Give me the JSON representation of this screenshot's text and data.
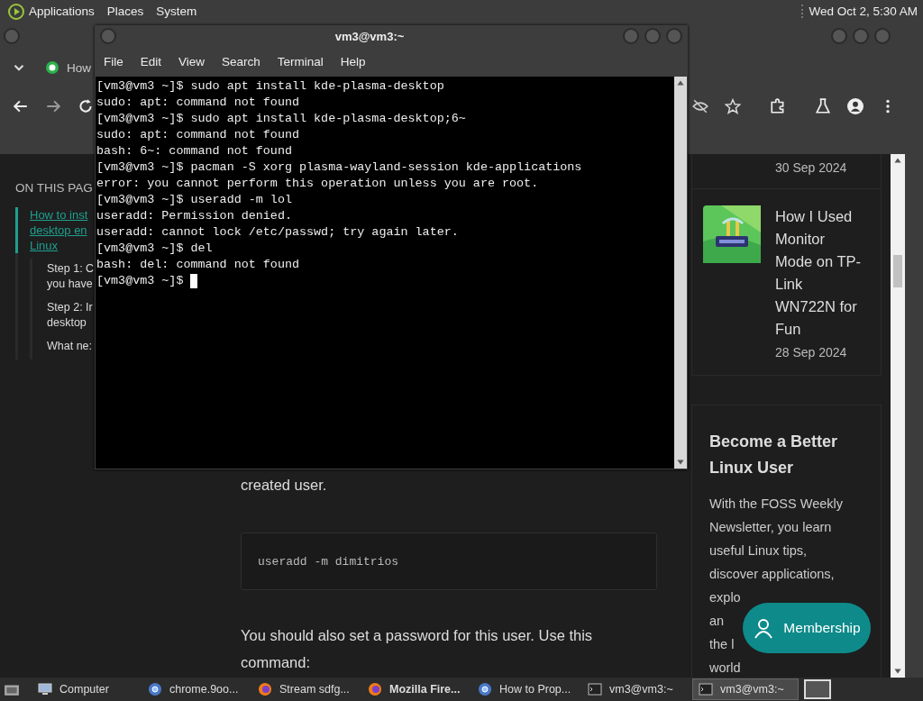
{
  "top_panel": {
    "menus": [
      "Applications",
      "Places",
      "System"
    ],
    "clock": "Wed Oct  2,  5:30 AM"
  },
  "browser": {
    "tab": {
      "title": "How"
    },
    "page": {
      "toc": {
        "heading": "ON THIS PAG",
        "items": [
          {
            "lines": [
              "How to inst",
              "desktop en",
              "Linux"
            ],
            "selected": true,
            "children": [
              {
                "lines": [
                  "Step 1: C",
                  "you have"
                ],
                "selected": false
              },
              {
                "lines": [
                  "Step 2: Ir",
                  "desktop"
                ],
                "selected": false
              },
              {
                "lines": [
                  "What ne:"
                ],
                "selected": false
              }
            ]
          }
        ]
      },
      "article": {
        "paragraph_1": "created user.",
        "code": "useradd -m dimitrios",
        "paragraph_2": "You should also set a password for this user. Use this command:"
      },
      "sidebar": {
        "posts": [
          {
            "date": "30 Sep 2024"
          },
          {
            "title": "How I Used Monitor Mode on TP-Link WN722N for Fun",
            "date": "28 Sep 2024",
            "kind": "picture"
          }
        ],
        "newsletter": {
          "heading": "Become a Better Linux User",
          "lines": [
            "With the FOSS Weekly",
            "Newsletter, you learn",
            "useful Linux tips,",
            "discover applications,",
            "explo",
            "an",
            "the l",
            "world"
          ]
        }
      },
      "membership_button": "Membership"
    }
  },
  "terminal": {
    "title": "vm3@vm3:~",
    "menus": [
      "File",
      "Edit",
      "View",
      "Search",
      "Terminal",
      "Help"
    ],
    "lines": [
      "[vm3@vm3 ~]$ sudo apt install kde-plasma-desktop",
      "sudo: apt: command not found",
      "[vm3@vm3 ~]$ sudo apt install kde-plasma-desktop;6~",
      "sudo: apt: command not found",
      "bash: 6~: command not found",
      "[vm3@vm3 ~]$ pacman -S xorg plasma-wayland-session kde-applications",
      "error: you cannot perform this operation unless you are root.",
      "[vm3@vm3 ~]$ useradd -m lol",
      "useradd: Permission denied.",
      "useradd: cannot lock /etc/passwd; try again later.",
      "[vm3@vm3 ~]$ del",
      "bash: del: command not found",
      "[vm3@vm3 ~]$ "
    ]
  },
  "taskbar": {
    "items": [
      {
        "label": "Computer",
        "kind": "computer",
        "selected": false,
        "bold": false
      },
      {
        "label": "chrome.9oo...",
        "kind": "chrome",
        "selected": false,
        "bold": false
      },
      {
        "label": "Stream sdfg...",
        "kind": "firefox",
        "selected": false,
        "bold": false
      },
      {
        "label": "Mozilla Fire...",
        "kind": "firefox",
        "selected": false,
        "bold": true
      },
      {
        "label": "How to Prop...",
        "kind": "chrome",
        "selected": false,
        "bold": false
      },
      {
        "label": "vm3@vm3:~",
        "kind": "terminal",
        "selected": false,
        "bold": false
      },
      {
        "label": "vm3@vm3:~",
        "kind": "terminal",
        "selected": true,
        "bold": false
      }
    ]
  }
}
